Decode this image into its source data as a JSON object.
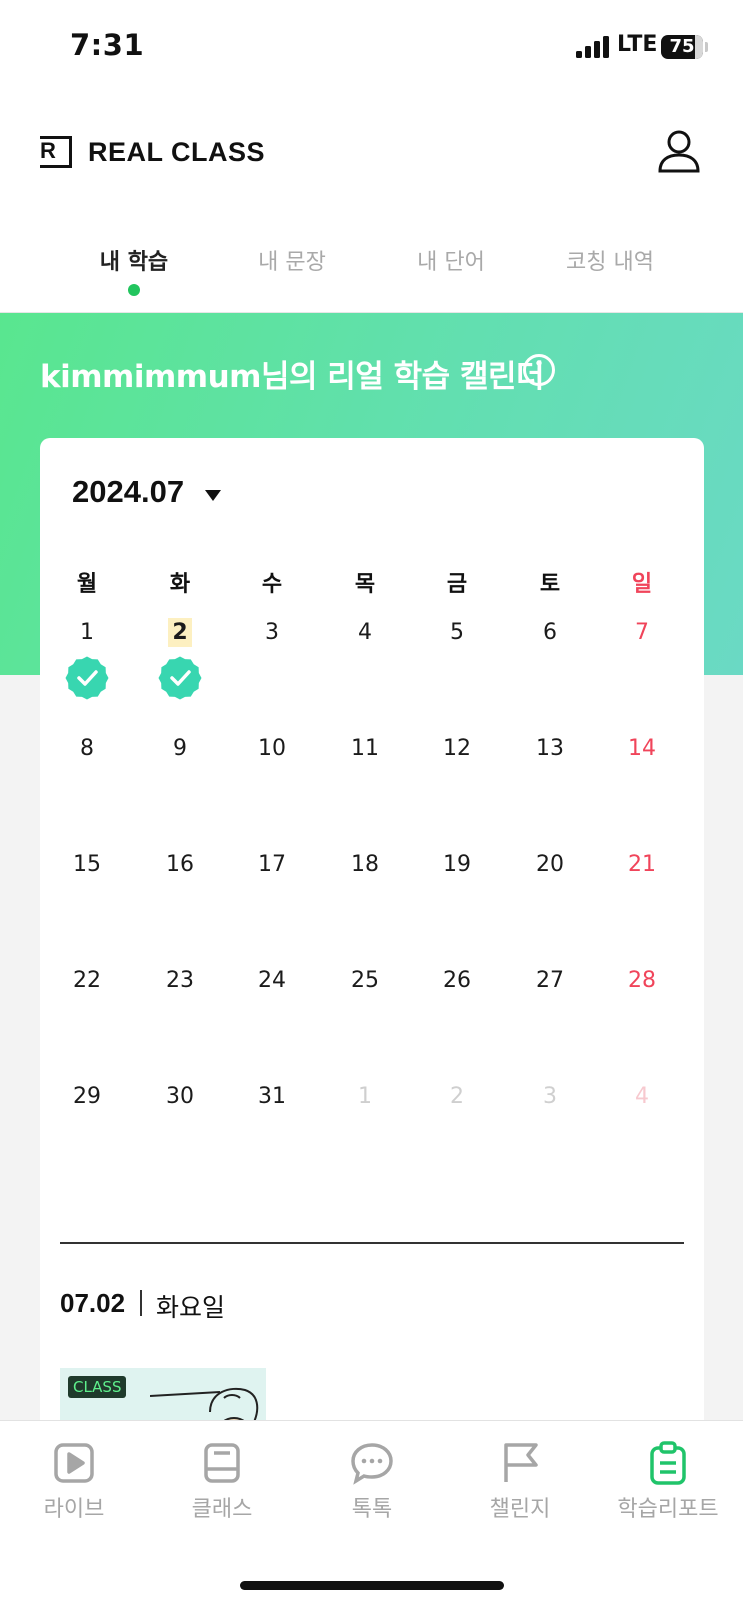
{
  "status_bar": {
    "time": "7:31",
    "network": "LTE",
    "battery": "75"
  },
  "header": {
    "brand": "REAL CLASS",
    "logo_letter": "R"
  },
  "tabs": [
    {
      "label": "내 학습",
      "active": true
    },
    {
      "label": "내 문장",
      "active": false
    },
    {
      "label": "내 단어",
      "active": false
    },
    {
      "label": "코칭 내역",
      "active": false
    }
  ],
  "banner": {
    "title": "kimmimmum님의 리얼 학습 캘린더"
  },
  "calendar": {
    "month": "2024.07",
    "weekdays": [
      "월",
      "화",
      "수",
      "목",
      "금",
      "토",
      "일"
    ],
    "weeks": [
      [
        "1",
        "2",
        "3",
        "4",
        "5",
        "6",
        "7"
      ],
      [
        "8",
        "9",
        "10",
        "11",
        "12",
        "13",
        "14"
      ],
      [
        "15",
        "16",
        "17",
        "18",
        "19",
        "20",
        "21"
      ],
      [
        "22",
        "23",
        "24",
        "25",
        "26",
        "27",
        "28"
      ],
      [
        "29",
        "30",
        "31",
        "1",
        "2",
        "3",
        "4"
      ]
    ],
    "studied_days": [
      "1",
      "2"
    ],
    "today": "2"
  },
  "selected": {
    "date": "07.02",
    "weekday": "화요일"
  },
  "lesson": {
    "badge": "CLASS"
  },
  "bottom_nav": [
    {
      "label": "라이브",
      "icon": "play-icon",
      "active": false
    },
    {
      "label": "클래스",
      "icon": "book-icon",
      "active": false
    },
    {
      "label": "톡톡",
      "icon": "chat-bubble-icon",
      "active": false
    },
    {
      "label": "챌린지",
      "icon": "flag-icon",
      "active": false
    },
    {
      "label": "학습리포트",
      "icon": "clipboard-icon",
      "active": true
    }
  ],
  "colors": {
    "accent": "#20c46a",
    "sunday": "#f0445a",
    "check": "#38d6b0",
    "today_highlight": "#fdf0c1"
  }
}
